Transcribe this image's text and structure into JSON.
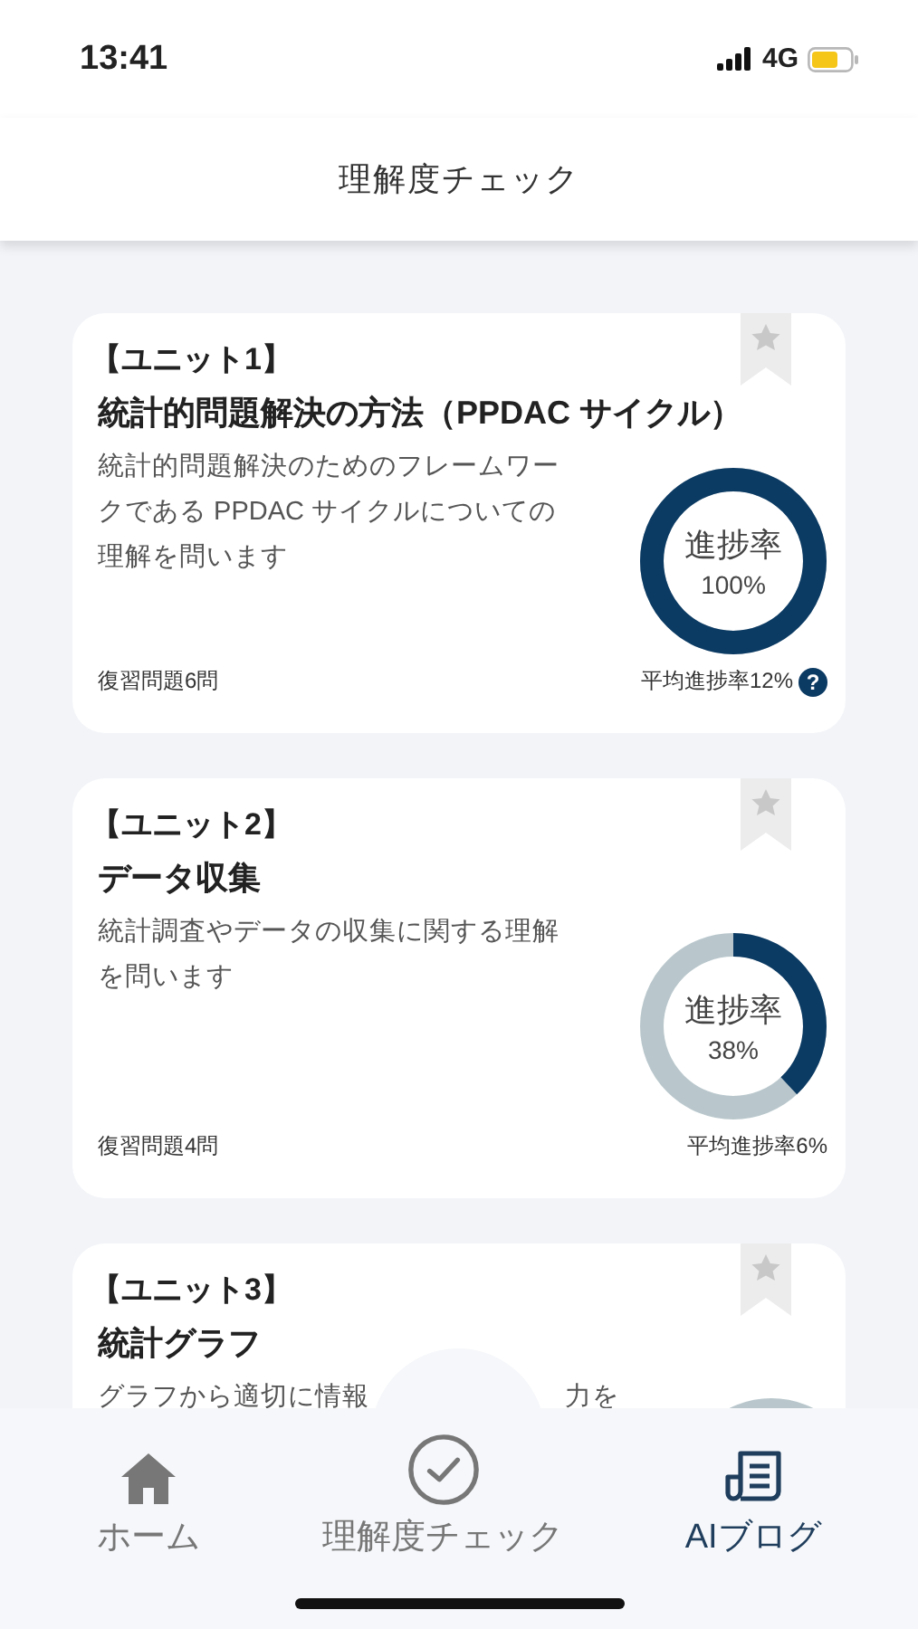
{
  "status_bar": {
    "time": "13:41",
    "network": "4G"
  },
  "header": {
    "title": "理解度チェック"
  },
  "units": [
    {
      "unit": "【ユニット1】",
      "title": "統計的問題解決の方法（PPDAC サイクル）",
      "description": [
        "統計的問題解決のためのフレームワークである PPDAC サイクルについての理解を問います"
      ],
      "bookmarked": false,
      "progress": {
        "label": "進捗率",
        "value": "100%",
        "level": 1
      },
      "review": "復習問題6問",
      "average": "平均進捗率12%",
      "help": "?"
    },
    {
      "unit": "【ユニット2】",
      "title": "データ収集",
      "description": [
        "統計調査やデータの収集に関する理解を問います"
      ],
      "bookmarked": false,
      "progress": {
        "label": "進捗率",
        "value": "38%",
        "level": 0.38
      },
      "review": "復習問題4問",
      "average": "平均進捗率6%"
    },
    {
      "unit": "【ユニット3】",
      "title": "統計グラフ",
      "description": [
        "グラフから適切に情報",
        "力を"
      ],
      "bookmarked": false
    }
  ],
  "tabs": [
    {
      "kind": "home",
      "label": "ホーム",
      "selected": false
    },
    {
      "kind": "check",
      "label": "理解度チェック",
      "selected": false
    },
    {
      "kind": "blog",
      "label": "AIブログ",
      "selected": true
    }
  ]
}
